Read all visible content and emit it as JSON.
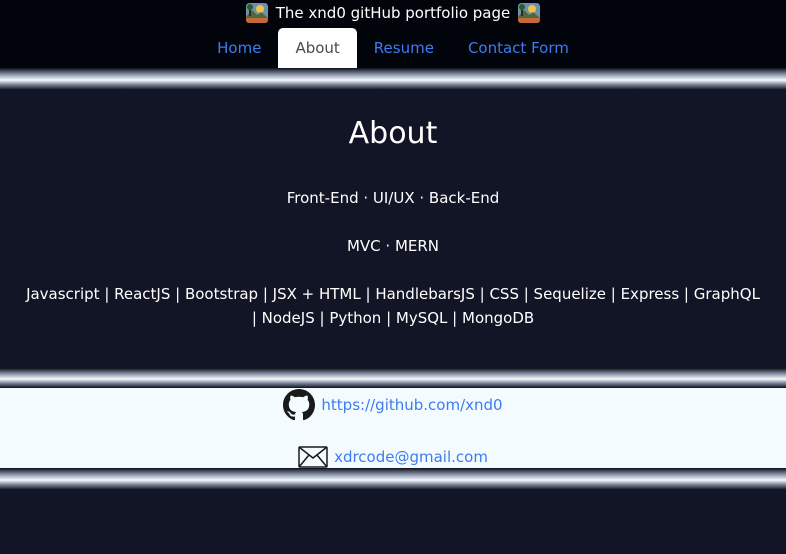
{
  "header": {
    "title": "The xnd0 gitHub portfolio page"
  },
  "nav": {
    "items": [
      {
        "label": "Home"
      },
      {
        "label": "About"
      },
      {
        "label": "Resume"
      },
      {
        "label": "Contact Form"
      }
    ],
    "active": "About"
  },
  "about": {
    "heading": "About",
    "line1": "Front-End · UI/UX · Back-End",
    "line2": "MVC · MERN",
    "line3": "Javascript | ReactJS | Bootstrap | JSX + HTML | HandlebarsJS | CSS | Sequelize | Express | GraphQL | NodeJS | Python | MySQL | MongoDB"
  },
  "contact": {
    "github_url": "https://github.com/xnd0",
    "email": "xdrcode@gmail.com"
  },
  "colors": {
    "background": "#121526",
    "topbar": "#02040c",
    "link": "#3d7cf0",
    "contact_bg": "#f3fbff"
  }
}
